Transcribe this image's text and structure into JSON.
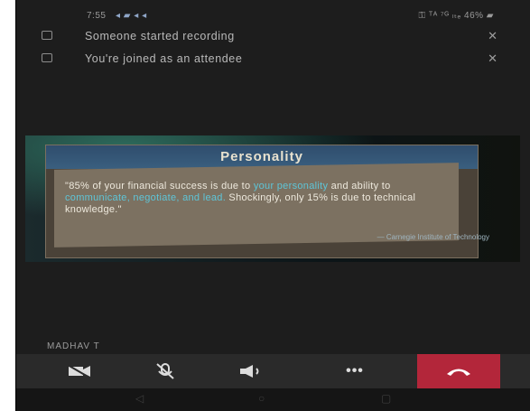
{
  "status_bar": {
    "time": "7:55",
    "left_icons_text": "◂ ▰ ◂ ◂",
    "right_text": "⚿ ᵀᴬ ⁷ᴳ ₗₜₑ 46% ▰"
  },
  "notifications": [
    {
      "icon": "recording-icon",
      "text": "Someone started recording",
      "close": "✕"
    },
    {
      "icon": "info-icon",
      "text": "You're joined as an attendee",
      "close": "✕"
    }
  ],
  "shared_screen": {
    "slide_title": "Personality",
    "quote_parts": [
      {
        "text": "\"85% of your financial success is due to ",
        "highlight": false
      },
      {
        "text": "your personality",
        "highlight": true
      },
      {
        "text": " and ability to ",
        "highlight": false
      },
      {
        "text": "communicate, negotiate, and lead.",
        "highlight": true
      },
      {
        "text": " Shockingly, only 15% is due to technical knowledge.\"",
        "highlight": false
      }
    ],
    "source": "— Carnegie Institute of Technology"
  },
  "presenter_name": "MADHAV T",
  "controls": {
    "camera": "camera-off-icon",
    "mic": "mic-off-icon",
    "speaker": "speaker-icon",
    "more": "•••",
    "hangup": "hang-up-icon"
  },
  "colors": {
    "hangup": "#b3263a",
    "highlight": "#5ec5d8",
    "background": "#1d1d1d"
  },
  "nav": {
    "back": "◁",
    "home": "○",
    "recent": "▢"
  }
}
